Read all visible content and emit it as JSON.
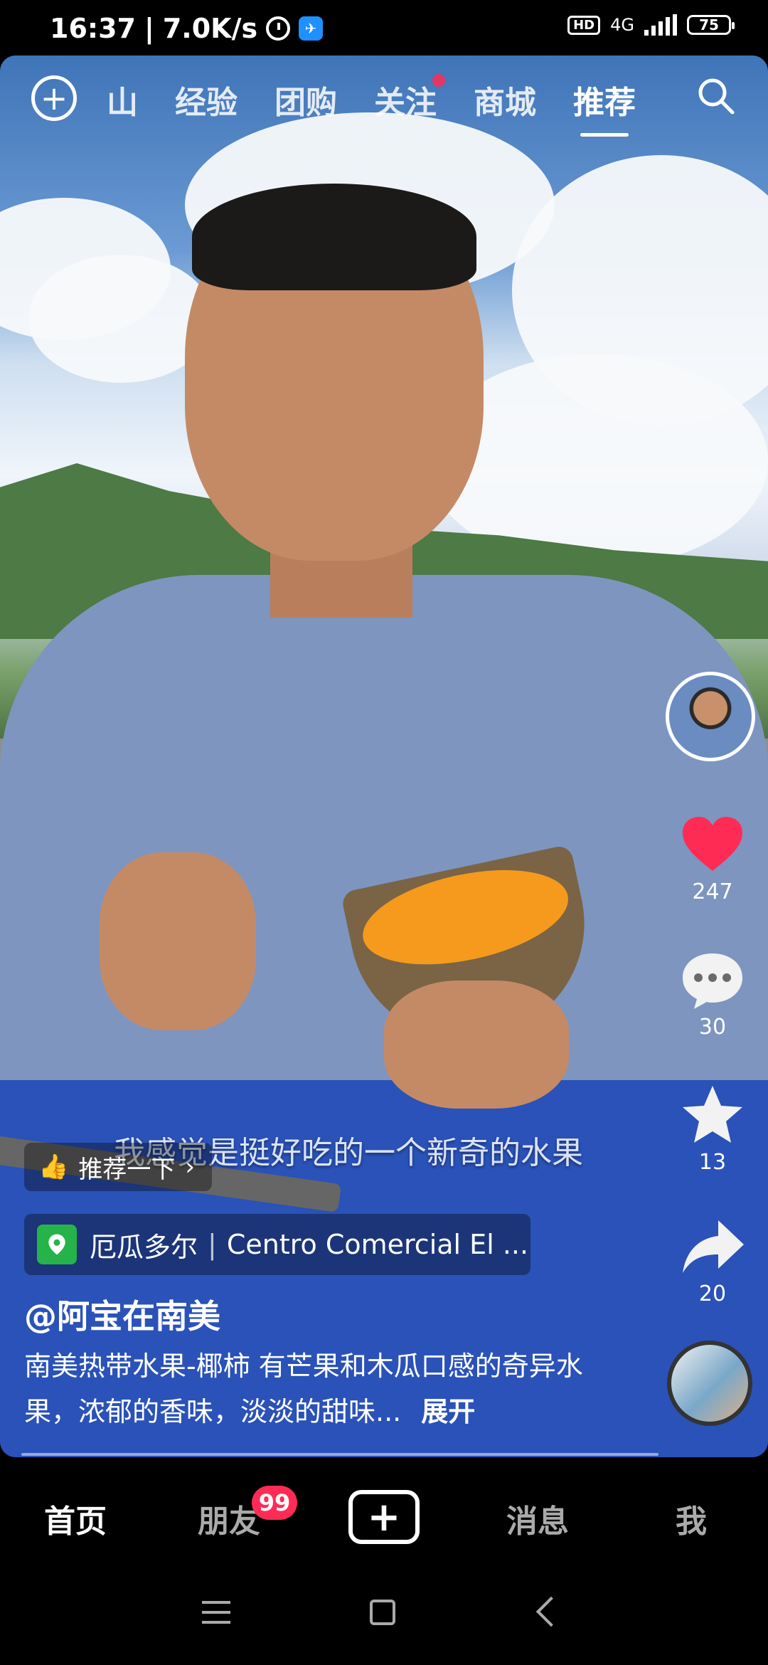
{
  "status_bar": {
    "time": "16:37",
    "speed": "7.0K/s",
    "hd": "HD",
    "network": "4G",
    "battery": "75"
  },
  "top_nav": {
    "tabs": [
      "山",
      "经验",
      "团购",
      "关注",
      "商城",
      "推荐"
    ],
    "active_tab": "推荐"
  },
  "side": {
    "likes": "247",
    "comments": "30",
    "favorites": "13",
    "shares": "20"
  },
  "video": {
    "subtitle": "我感觉是挺好吃的一个新奇的水果",
    "recommend_label": "推荐一下",
    "location_country": "厄瓜多尔",
    "location_place": "Centro Comercial El ...",
    "author": "@阿宝在南美",
    "description": "南美热带水果-椰柿 有芒果和木瓜口感的奇异水果，浓郁的香味，淡淡的甜味...",
    "expand_label": "展开",
    "progress": 0.0
  },
  "bottom_nav": {
    "home": "首页",
    "friends": "朋友",
    "friends_badge": "99",
    "messages": "消息",
    "me": "我"
  },
  "colors": {
    "accent": "#fe2c55",
    "location_pin": "#25b34a"
  }
}
